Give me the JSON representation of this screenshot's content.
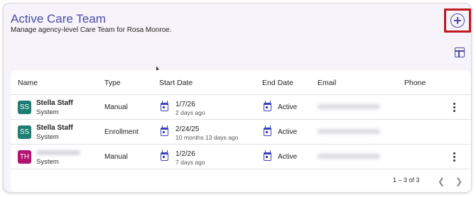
{
  "header": {
    "title": "Active Care Team",
    "subtitle": "Manage agency-level Care Team for Rosa Monroe."
  },
  "table": {
    "columns": [
      "Name",
      "Type",
      "Start Date",
      "End Date",
      "Email",
      "Phone"
    ],
    "rows": [
      {
        "initials": "SS",
        "avatar_color": "#1e7d73",
        "name": "Stella Staff",
        "source": "System",
        "type": "Manual",
        "start_date": "1/7/26",
        "start_ago": "2 days ago",
        "end_date": "Active",
        "has_menu": true
      },
      {
        "initials": "SS",
        "avatar_color": "#1e7d73",
        "name": "Stella Staff",
        "source": "System",
        "type": "Enrollment",
        "start_date": "2/24/25",
        "start_ago": "10 months 13 days ago",
        "end_date": "Active",
        "has_menu": false
      },
      {
        "initials": "TH",
        "avatar_color": "#b3126f",
        "name": "",
        "source": "System",
        "type": "Manual",
        "start_date": "1/2/26",
        "start_ago": "7 days ago",
        "end_date": "Active",
        "has_menu": true
      }
    ]
  },
  "pagination": {
    "range_label": "1 – 3 of 3"
  },
  "colors": {
    "accent": "#4a4aa8",
    "highlight_frame": "#c0181f",
    "calendar_icon": "#3b3fb8"
  },
  "icons": {
    "add": "add-circle-icon",
    "columns": "table-columns-icon",
    "calendar": "calendar-icon",
    "row_menu": "more-vert-icon",
    "prev": "chevron-left-icon",
    "next": "chevron-right-icon"
  }
}
